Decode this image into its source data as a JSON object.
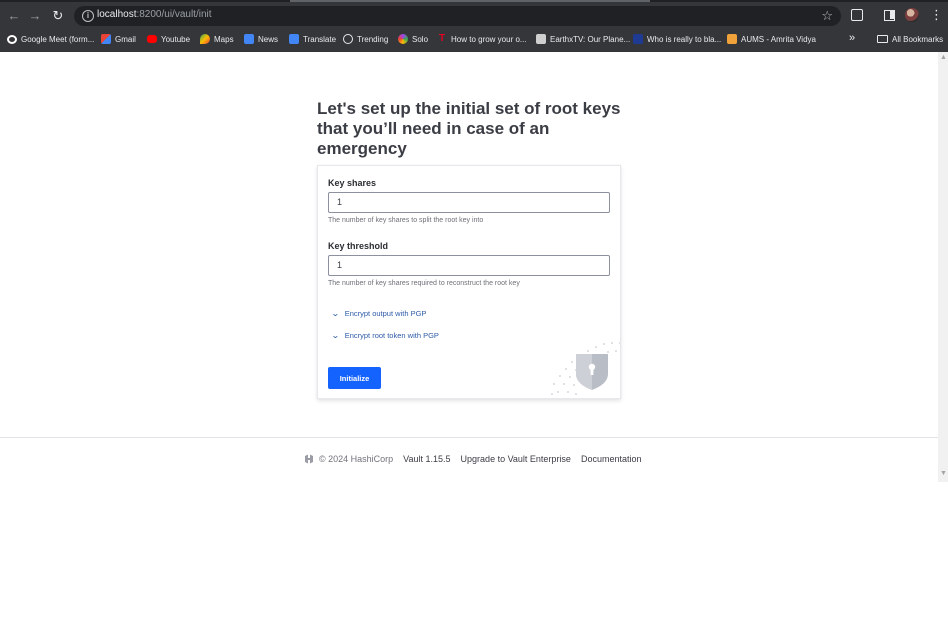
{
  "browser": {
    "url_host": "localhost",
    "url_path": ":8200/ui/vault/init",
    "bookmarks": [
      {
        "label": "Google Meet (form...",
        "icon": "google-icon",
        "color": "#ffffff"
      },
      {
        "label": "Gmail",
        "icon": "gmail-icon",
        "color": "#ea4335"
      },
      {
        "label": "Youtube",
        "icon": "youtube-icon",
        "color": "#ff0000"
      },
      {
        "label": "Maps",
        "icon": "maps-icon",
        "color": "#34a853"
      },
      {
        "label": "News",
        "icon": "news-icon",
        "color": "#4285f4"
      },
      {
        "label": "Translate",
        "icon": "translate-icon",
        "color": "#4285f4"
      },
      {
        "label": "Trending",
        "icon": "trending-icon",
        "color": "#e8eaed"
      },
      {
        "label": "Solo",
        "icon": "solo-icon",
        "color": "#a142f4"
      },
      {
        "label": "How to grow your o...",
        "icon": "pinterest-icon",
        "color": "#e60023"
      },
      {
        "label": "EarthxTV: Our Plane...",
        "icon": "earthx-icon",
        "color": "#cfcfcf"
      },
      {
        "label": "Who is really to bla...",
        "icon": "video-icon",
        "color": "#1f3a93"
      },
      {
        "label": "AUMS - Amrita Vidya",
        "icon": "aums-icon",
        "color": "#f2a23a"
      }
    ],
    "all_bookmarks": "All Bookmarks"
  },
  "page": {
    "title": "Let's set up the initial set of root keys that you’ll need in case of an emergency",
    "key_shares": {
      "label": "Key shares",
      "value": "1",
      "help": "The number of key shares to split the root key into"
    },
    "key_threshold": {
      "label": "Key threshold",
      "value": "1",
      "help": "The number of key shares required to reconstruct the root key"
    },
    "toggles": [
      {
        "label": "Encrypt output with PGP"
      },
      {
        "label": "Encrypt root token with PGP"
      }
    ],
    "initialize_label": "Initialize",
    "accent_color": "#1563ff"
  },
  "footer": {
    "copyright": "© 2024 HashiCorp",
    "version": "Vault 1.15.5",
    "upgrade": "Upgrade to Vault Enterprise",
    "docs": "Documentation"
  }
}
